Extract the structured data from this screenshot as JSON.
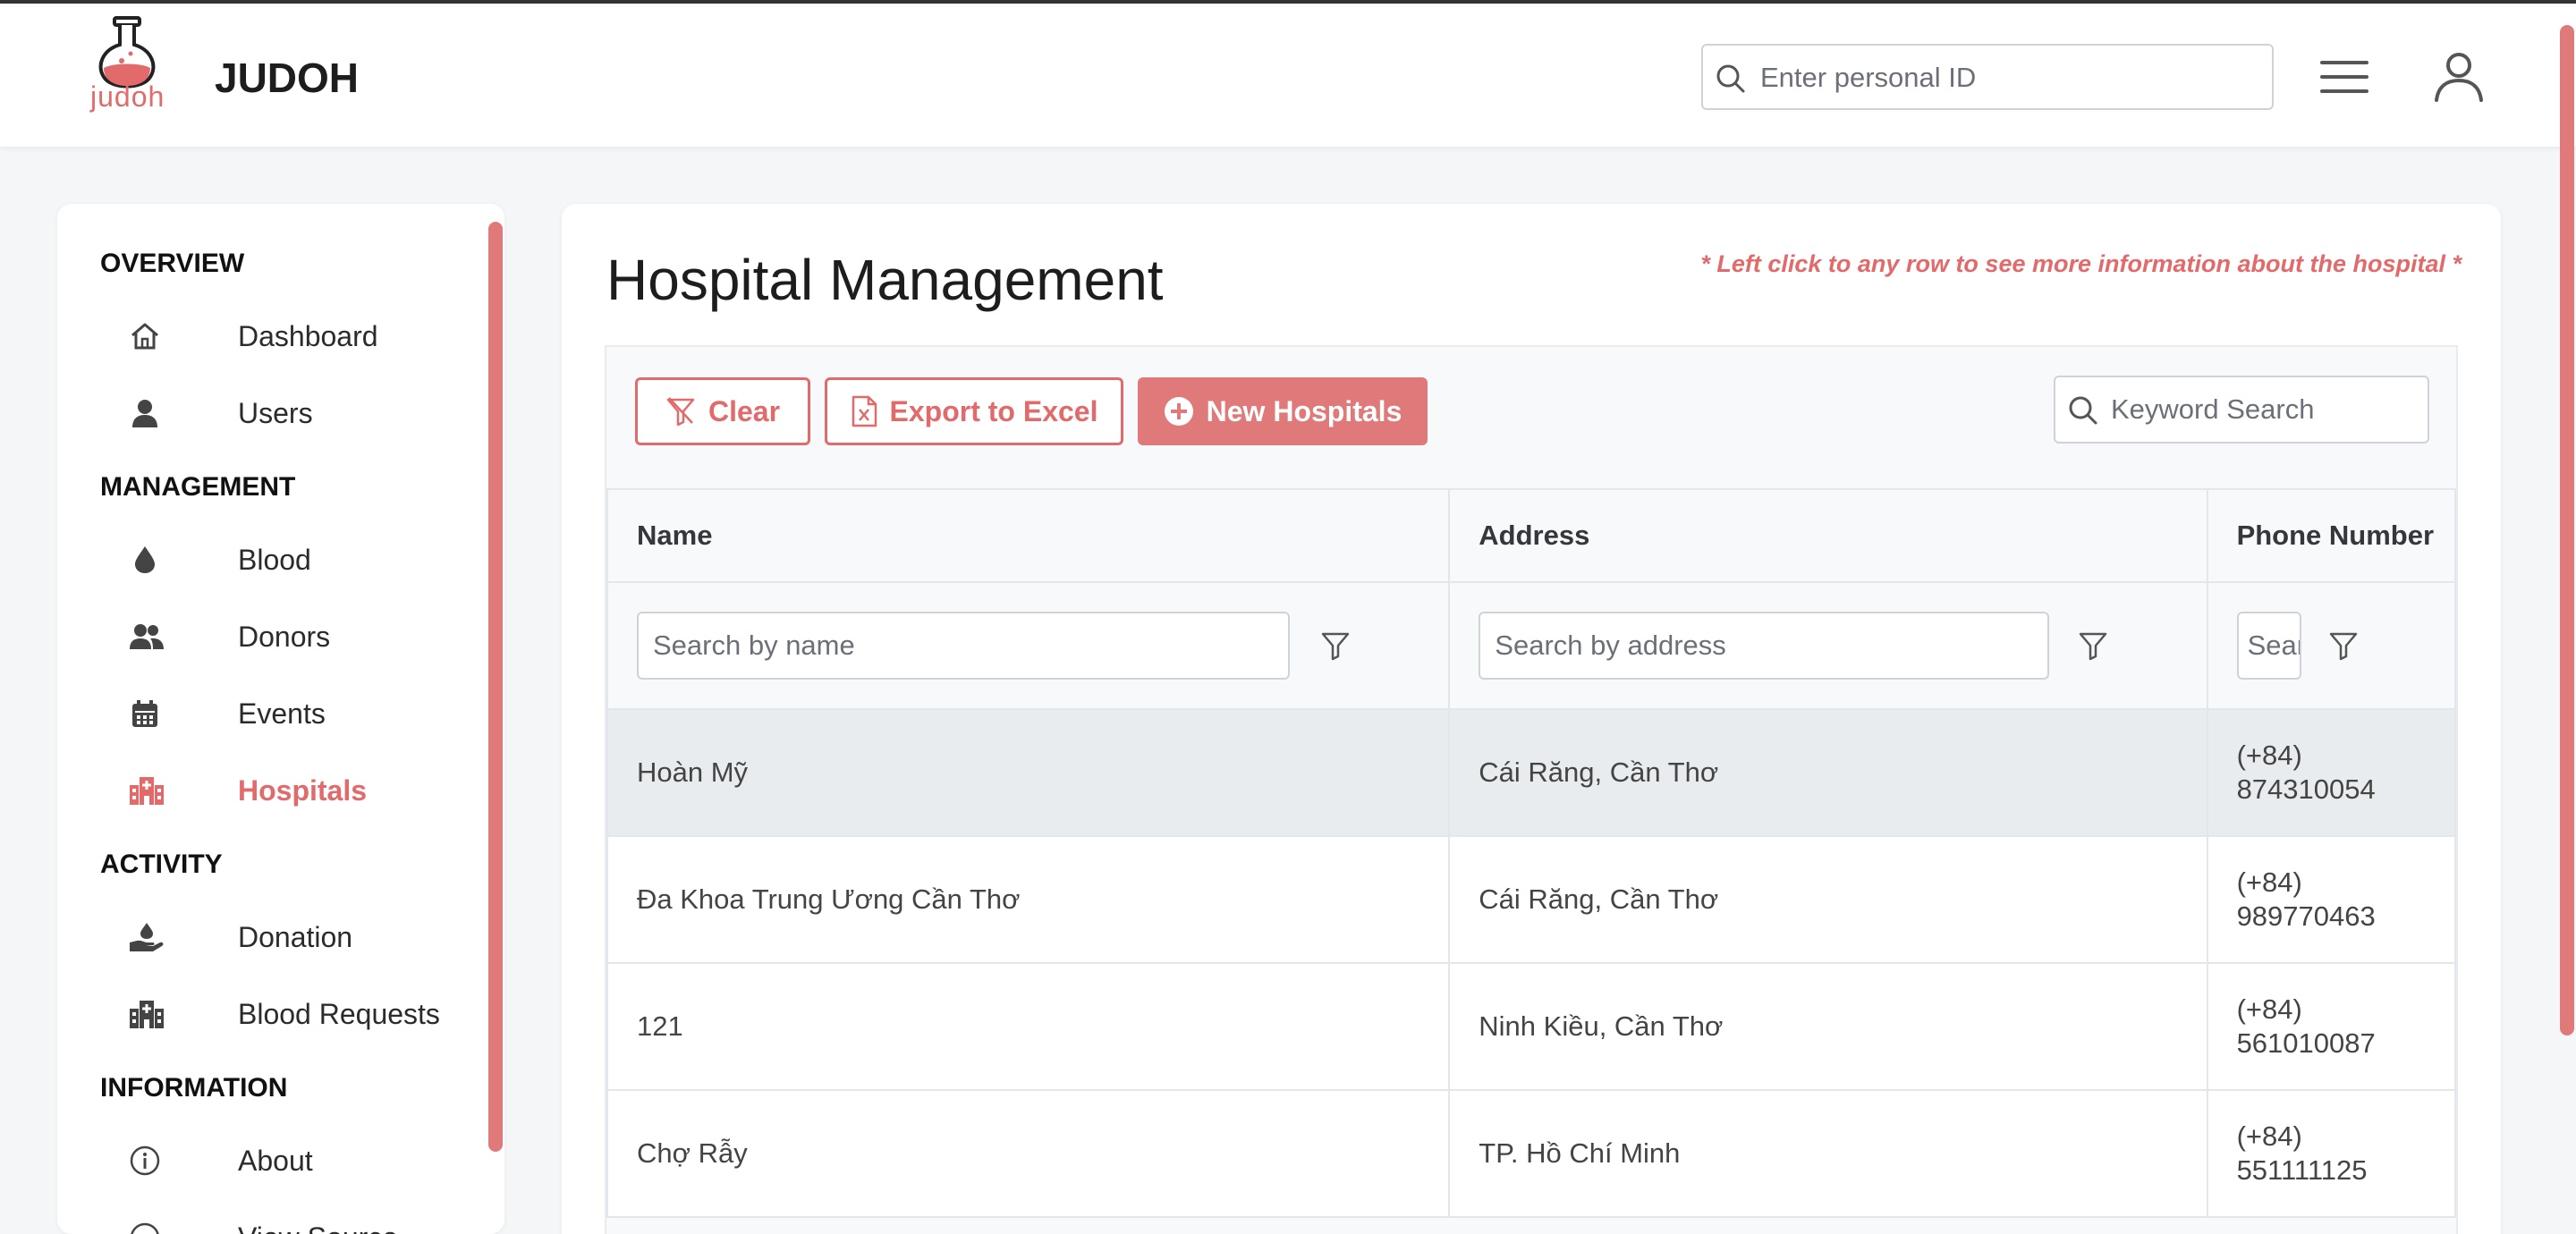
{
  "app": {
    "logo_text": "judoh",
    "title": "JUDOH",
    "search_placeholder": "Enter personal ID"
  },
  "sidebar": {
    "sections": [
      {
        "title": "OVERVIEW",
        "items": [
          {
            "label": "Dashboard",
            "icon": "home-icon"
          },
          {
            "label": "Users",
            "icon": "user-icon"
          }
        ]
      },
      {
        "title": "MANAGEMENT",
        "items": [
          {
            "label": "Blood",
            "icon": "blood-drop-icon"
          },
          {
            "label": "Donors",
            "icon": "people-icon"
          },
          {
            "label": "Events",
            "icon": "calendar-icon"
          },
          {
            "label": "Hospitals",
            "icon": "hospital-icon",
            "active": true
          }
        ]
      },
      {
        "title": "ACTIVITY",
        "items": [
          {
            "label": "Donation",
            "icon": "hand-donate-icon"
          },
          {
            "label": "Blood Requests",
            "icon": "hospital-icon"
          }
        ]
      },
      {
        "title": "INFORMATION",
        "items": [
          {
            "label": "About",
            "icon": "info-icon"
          },
          {
            "label": "View Source",
            "icon": "source-icon"
          }
        ]
      }
    ]
  },
  "main": {
    "title": "Hospital Management",
    "hint": "* Left click to any row to see more information about the hospital *",
    "toolbar": {
      "clear_label": "Clear",
      "export_label": "Export to Excel",
      "new_label": "New Hospitals",
      "keyword_placeholder": "Keyword Search"
    },
    "table": {
      "columns": [
        "Name",
        "Address",
        "Phone Number"
      ],
      "filters": {
        "name_placeholder": "Search by name",
        "address_placeholder": "Search by address",
        "phone_placeholder": "Search by phone"
      },
      "rows": [
        {
          "name": "Hoàn Mỹ",
          "address": "Cái Răng, Cần Thơ",
          "phone_prefix": "(+84)",
          "phone_number": "874310054"
        },
        {
          "name": "Đa Khoa Trung Ương Cần Thơ",
          "address": "Cái Răng, Cần Thơ",
          "phone_prefix": "(+84)",
          "phone_number": "989770463"
        },
        {
          "name": "121",
          "address": "Ninh Kiều, Cần Thơ",
          "phone_prefix": "(+84)",
          "phone_number": "561010087"
        },
        {
          "name": "Chợ Rẫy",
          "address": "TP. Hồ Chí Minh",
          "phone_prefix": "(+84)",
          "phone_number": "551111125"
        }
      ]
    }
  },
  "colors": {
    "accent": "#e26a6a",
    "accent_solid": "#e07a7a",
    "background": "#f5f6f8",
    "row_hover": "#e9ecef"
  }
}
